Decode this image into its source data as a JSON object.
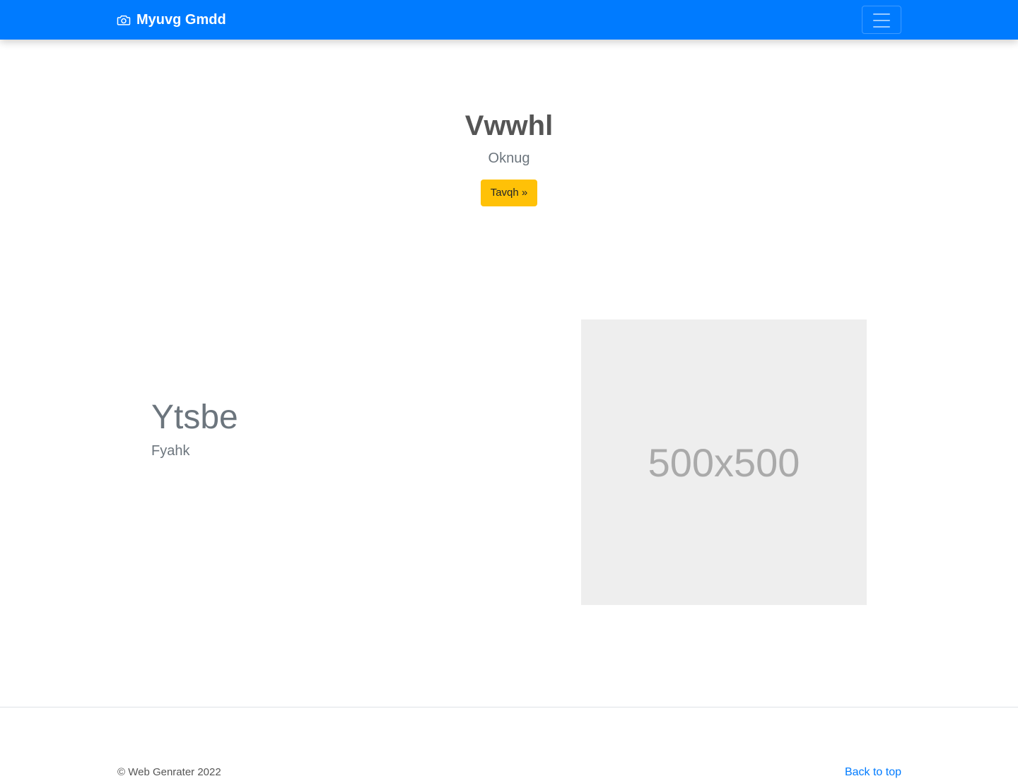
{
  "navbar": {
    "brand": "Myuvg Gmdd",
    "brand_icon": "camera-icon",
    "toggler_icon": "hamburger-menu-icon",
    "background": "#007bff"
  },
  "hero": {
    "title": "Vwwhl",
    "subtitle": "Oknug",
    "button_label": "Tavqh »",
    "button_color": "#ffc107"
  },
  "feature": {
    "title": "Ytsbe",
    "subtitle": "Fyahk",
    "image_placeholder": "500x500"
  },
  "footer": {
    "copyright": "© Web Genrater 2022",
    "back_to_top": "Back to top",
    "link_color": "#007bff"
  }
}
